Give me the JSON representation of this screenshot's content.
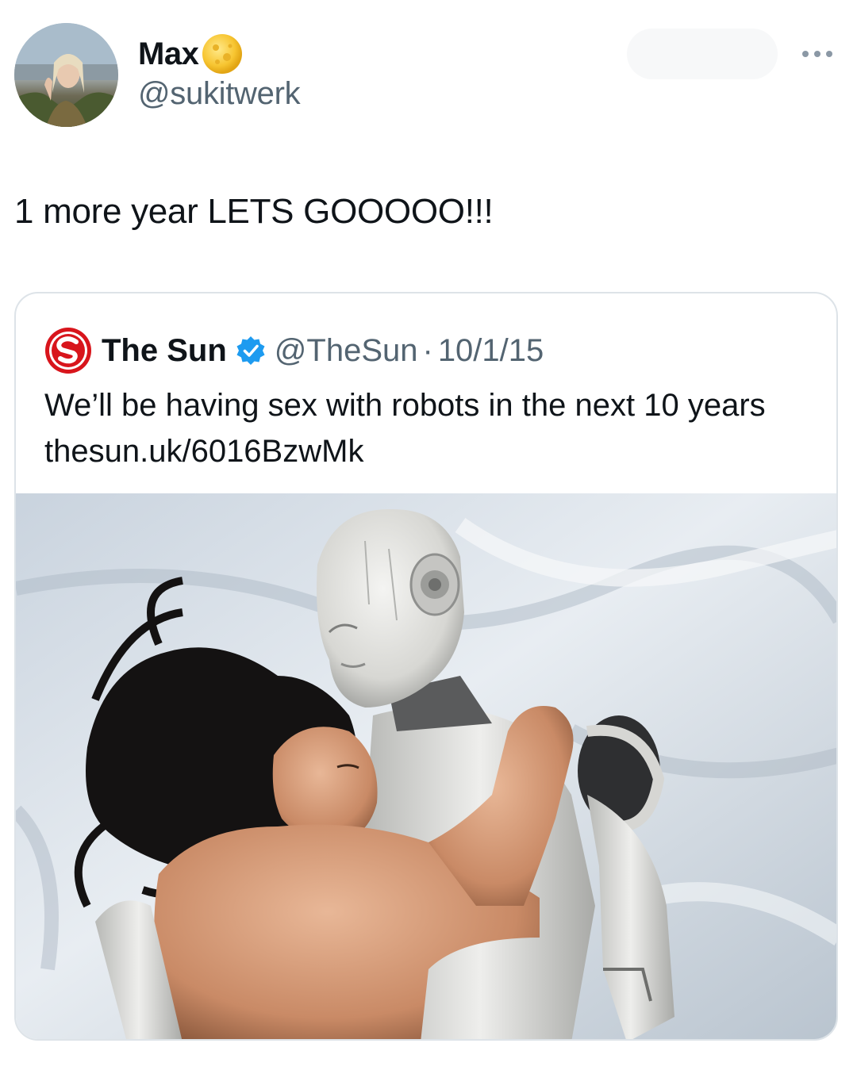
{
  "tweet": {
    "display_name": "Max",
    "handle": "@sukitwerk",
    "text": "1 more year LETS GOOOOO!!!",
    "badge_icon": "moon-emoji-icon",
    "menu_icon": "more-options-icon"
  },
  "quote": {
    "name": "The Sun",
    "handle": "@TheSun",
    "separator": "·",
    "date": "10/1/15",
    "verified": true,
    "text": "We’ll be having sex with robots in the next 10 years thesun.uk/6016BzwMk",
    "logo_icon": "the-sun-logo-icon",
    "verified_color": "#1d9bf0"
  },
  "colors": {
    "secondary_text": "#536471",
    "border": "#dde3e8",
    "sun_red": "#d8151c"
  }
}
